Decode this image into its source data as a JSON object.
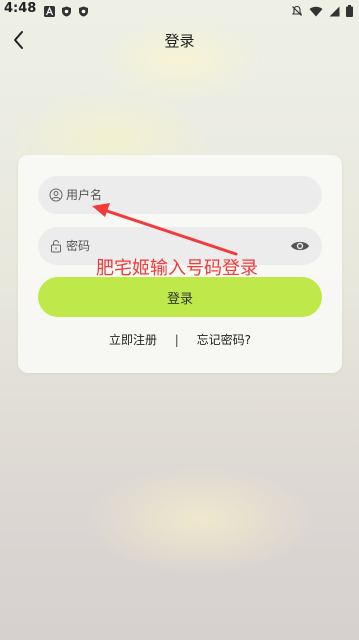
{
  "status_bar": {
    "time": "4:48",
    "left_icons": [
      "notification-a-icon",
      "shield-icon",
      "shield-icon"
    ],
    "right_icons": [
      "mute-icon",
      "wifi-icon",
      "signal-icon",
      "battery-icon"
    ]
  },
  "header": {
    "title": "登录"
  },
  "form": {
    "username_placeholder": "用户名",
    "password_placeholder": "密码",
    "login_label": "登录"
  },
  "links": {
    "register_label": "立即注册",
    "separator": "|",
    "forgot_label": "忘记密码?"
  },
  "annotation": {
    "text": "肥宅姬输入号码登录",
    "color": "#f23a3a"
  },
  "colors": {
    "accent": "#bfe94a",
    "annotation": "#f23a3a"
  }
}
